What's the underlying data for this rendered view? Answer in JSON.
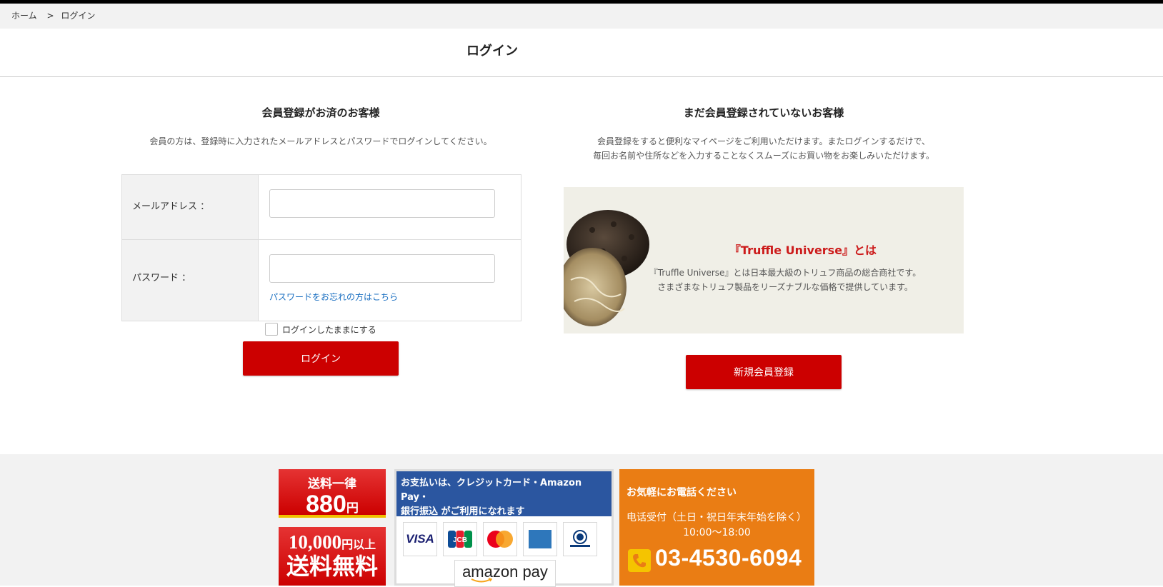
{
  "breadcrumb": {
    "home": "ホーム",
    "separator": ">",
    "current": "ログイン"
  },
  "page_title": "ログイン",
  "login": {
    "heading": "会員登録がお済のお客様",
    "description": "会員の方は、登録時に入力されたメールアドレスとパスワードでログインしてください。",
    "email_label": "メールアドレス ：",
    "email_value": "",
    "password_label": "パスワード ：",
    "password_value": "",
    "forgot_link": "パスワードをお忘れの方はこちら",
    "remember_label": "ログインしたままにする",
    "remember_checked": false,
    "button_label": "ログイン"
  },
  "register": {
    "heading": "まだ会員登録されていないお客様",
    "description_line1": "会員登録をすると便利なマイページをご利用いただけます。またログインするだけで、",
    "description_line2": "毎回お名前や住所などを入力することなくスムーズにお買い物をお楽しみいただけます。",
    "promo_title": "『Truffle Universe』とは",
    "promo_line1": "『Truffle Universe』とは日本最大級のトリュフ商品の総合商社です。",
    "promo_line2": "さまざまなトリュフ製品をリーズナブルな価格で提供しています。",
    "button_label": "新規会員登録"
  },
  "footer": {
    "shipping": {
      "flat_label": "送料一律",
      "flat_price": "880",
      "flat_unit": "円",
      "free_threshold": "10,000",
      "free_threshold_unit": "円以上",
      "free_label": "送料無料"
    },
    "payment": {
      "heading_line1": "お支払いは、クレジットカード・Amazon Pay・",
      "heading_line2": "銀行振込 がご利用になれます",
      "cards": [
        "VISA",
        "JCB",
        "MasterCard",
        "AMERICAN EXPRESS",
        "Diners Club"
      ],
      "amazon_pay": "amazon pay"
    },
    "phone": {
      "heading": "お気軽にお電話ください",
      "hours_note": "电话受付（土日・祝日年末年始を除く）",
      "hours": "10:00〜18:00",
      "number": "03-4530-6094"
    }
  },
  "colors": {
    "accent_red": "#cc0000",
    "link_blue": "#1a6fc1",
    "payment_blue": "#2b56a0",
    "phone_orange": "#ea7d14"
  }
}
